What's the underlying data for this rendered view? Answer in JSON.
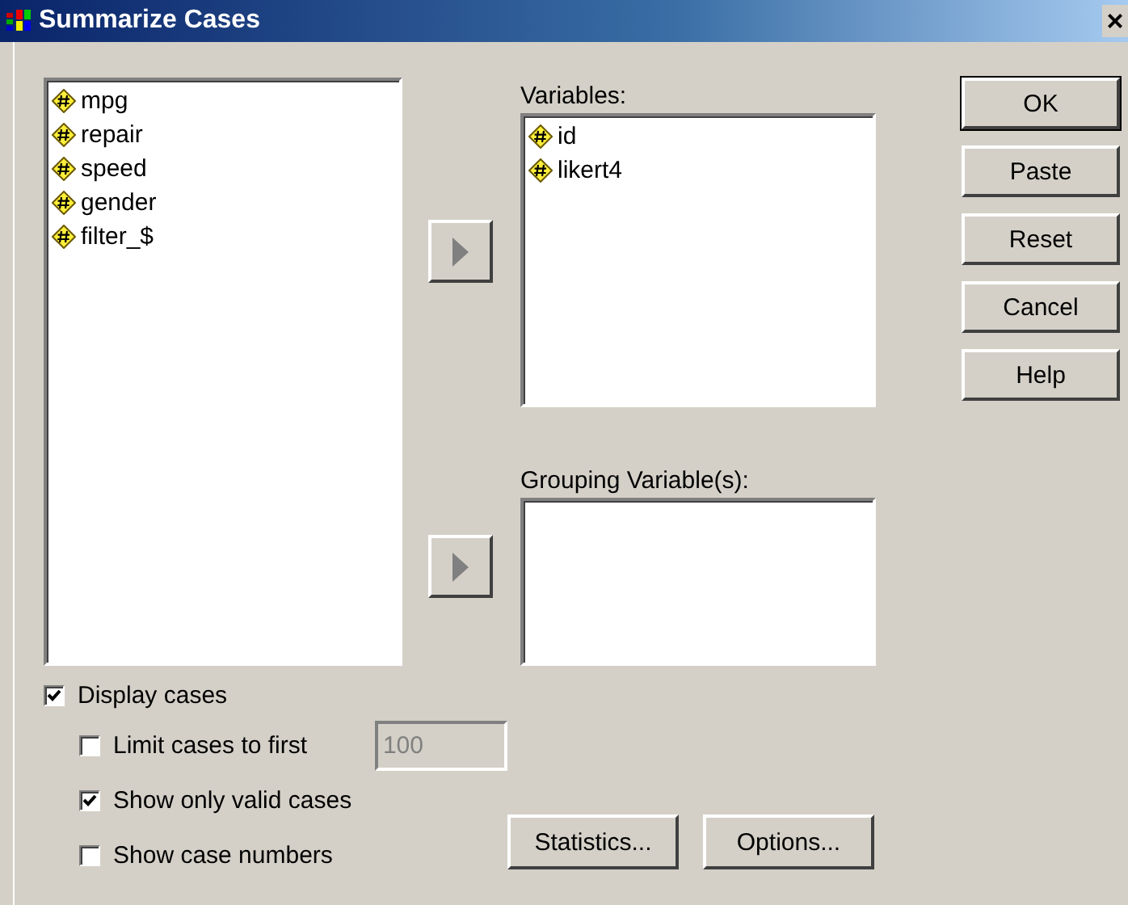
{
  "window": {
    "title": "Summarize Cases",
    "close": "×"
  },
  "source_list": {
    "items": [
      "mpg",
      "repair",
      "speed",
      "gender",
      "filter_$"
    ]
  },
  "variables": {
    "label": "Variables:",
    "items": [
      "id",
      "likert4"
    ]
  },
  "grouping": {
    "label": "Grouping Variable(s):"
  },
  "buttons": [
    {
      "label": "OK",
      "default": true
    },
    {
      "label": "Paste",
      "default": false
    },
    {
      "label": "Reset",
      "default": false
    },
    {
      "label": "Cancel",
      "default": false
    },
    {
      "label": "Help",
      "default": false
    }
  ],
  "display_cases": {
    "label": "Display cases",
    "checked": true,
    "children": [
      {
        "label": "Limit cases to first",
        "checked": false,
        "field": {
          "value": "100",
          "disabled": true
        }
      },
      {
        "label": "Show only valid cases",
        "checked": true
      },
      {
        "label": "Show case numbers",
        "checked": false
      }
    ]
  },
  "bottom_buttons": [
    "Statistics...",
    "Options..."
  ]
}
